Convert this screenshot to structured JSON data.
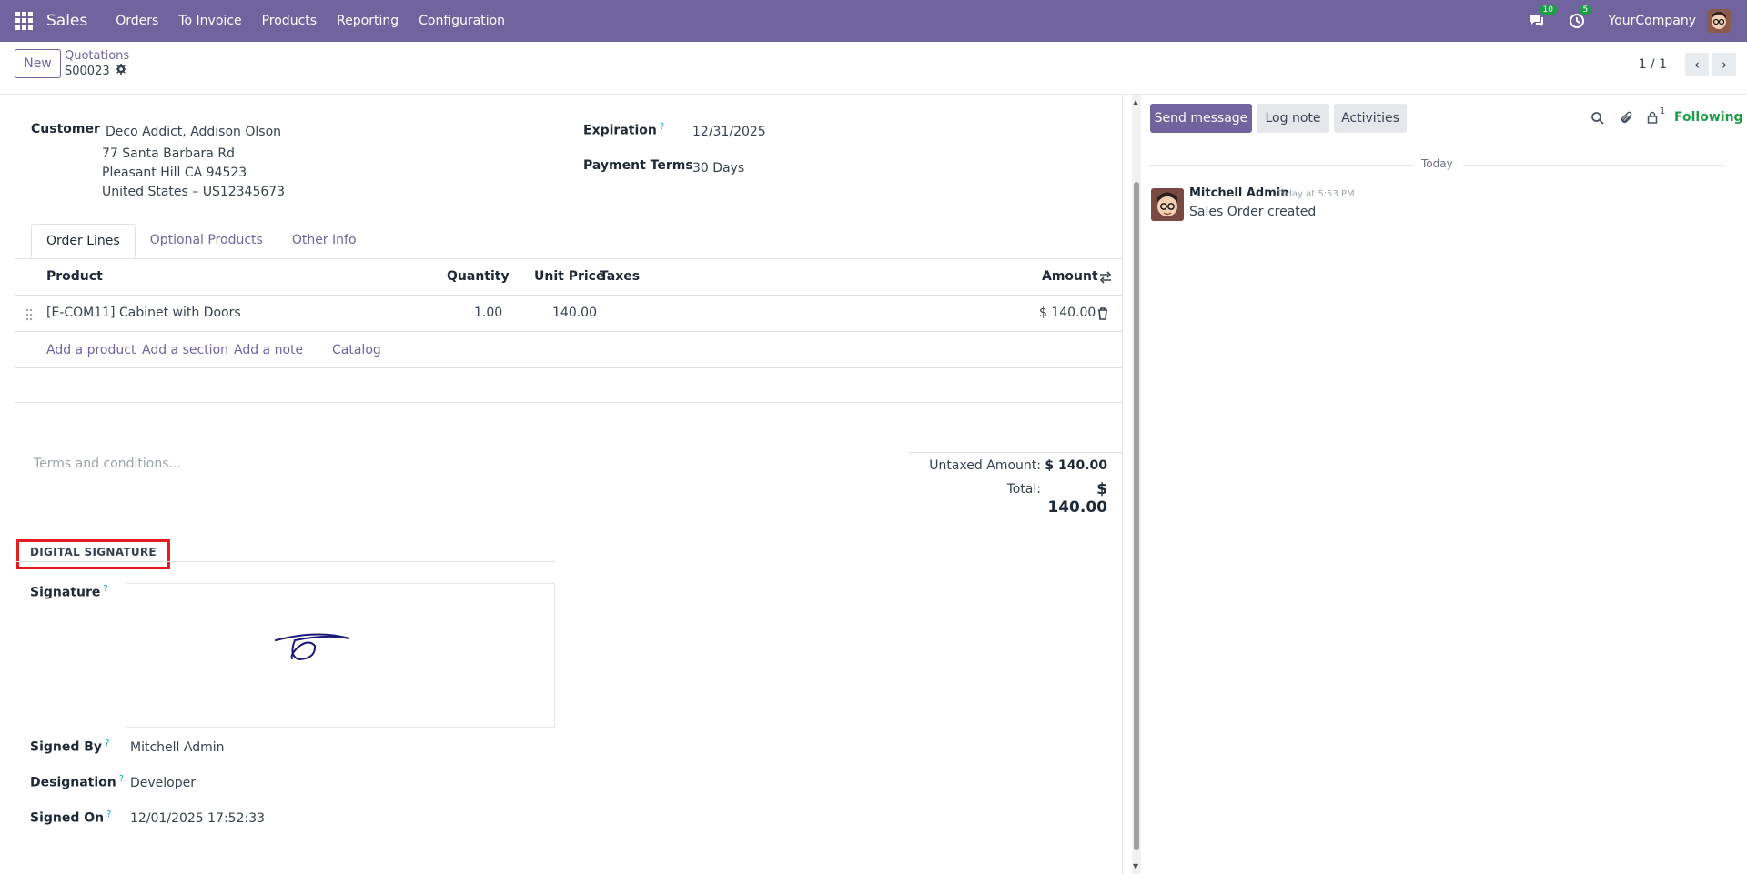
{
  "app": {
    "name": "Sales",
    "menu": [
      "Orders",
      "To Invoice",
      "Products",
      "Reporting",
      "Configuration"
    ],
    "messages_badge": "10",
    "activities_badge": "5",
    "company": "YourCompany"
  },
  "control": {
    "new_label": "New",
    "breadcrumb_parent": "Quotations",
    "breadcrumb_current": "S00023",
    "pager": "1 / 1"
  },
  "form": {
    "customer_label": "Customer",
    "customer_name": "Deco Addict, Addison Olson",
    "customer_address": [
      "77 Santa Barbara Rd",
      "Pleasant Hill CA 94523",
      "United States – US12345673"
    ],
    "expiration_label": "Expiration",
    "expiration_value": "12/31/2025",
    "payment_terms_label": "Payment Terms",
    "payment_terms_value": "30 Days",
    "tabs": [
      "Order Lines",
      "Optional Products",
      "Other Info"
    ],
    "columns": {
      "product": "Product",
      "quantity": "Quantity",
      "unit_price": "Unit Price",
      "taxes": "Taxes",
      "amount": "Amount"
    },
    "lines": [
      {
        "product": "[E-COM11] Cabinet with Doors",
        "quantity": "1.00",
        "unit_price": "140.00",
        "taxes": "",
        "amount": "$ 140.00"
      }
    ],
    "add_links": [
      "Add a product",
      "Add a section",
      "Add a note",
      "Catalog"
    ],
    "terms_placeholder": "Terms and conditions...",
    "untaxed_label": "Untaxed Amount:",
    "untaxed_value": "$ 140.00",
    "total_label": "Total:",
    "total_value": "$ 140.00",
    "signature_section": "DIGITAL SIGNATURE",
    "signature_label": "Signature",
    "signed_by_label": "Signed By",
    "signed_by_value": "Mitchell Admin",
    "designation_label": "Designation",
    "designation_value": "Developer",
    "signed_on_label": "Signed On",
    "signed_on_value": "12/01/2025 17:52:33"
  },
  "chatter": {
    "send_message": "Send message",
    "log_note": "Log note",
    "activities": "Activities",
    "followers_count": "1",
    "following": "Following",
    "day_separator": "Today",
    "messages": [
      {
        "author": "Mitchell Admin",
        "date": "Today at 5:53 PM",
        "body": "Sales Order created"
      }
    ]
  }
}
